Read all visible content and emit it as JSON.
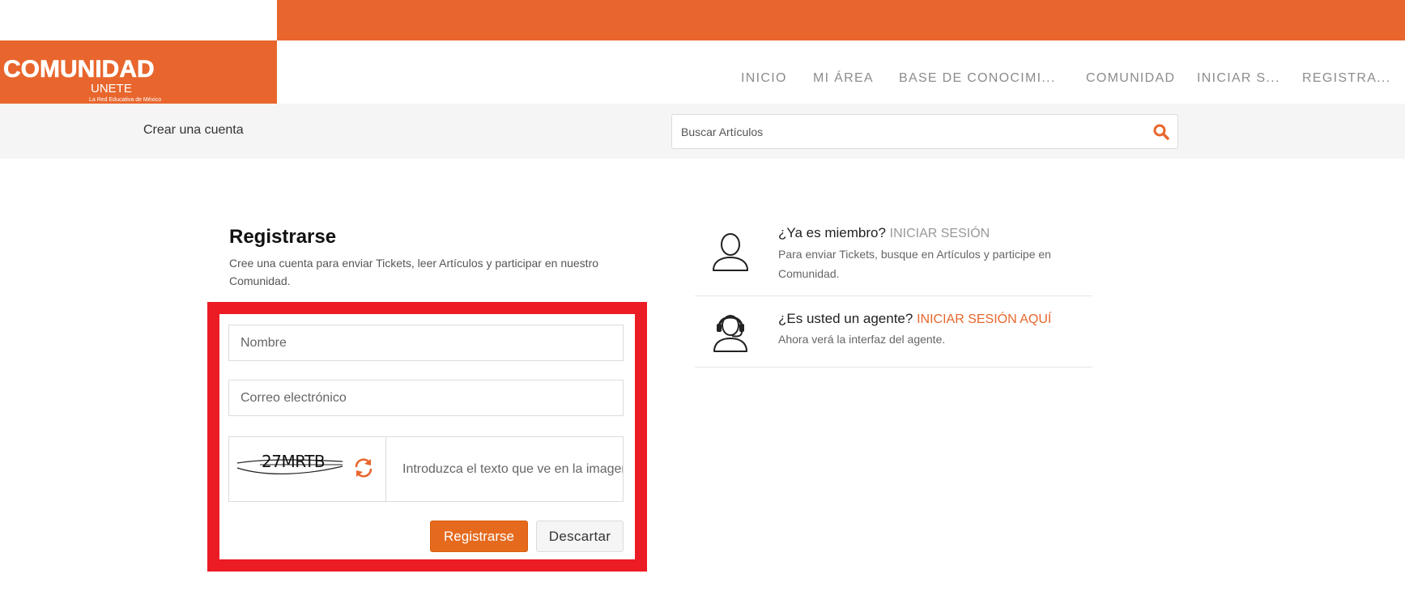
{
  "brand": {
    "logo_word": "COMUNIDAD",
    "logo_sub": "UNETE",
    "logo_tagline": "La Red Educativa de México",
    "accent": "#e8662d"
  },
  "nav": {
    "items": [
      {
        "label": "INICIO"
      },
      {
        "label": "MI ÁREA"
      },
      {
        "label": "BASE DE CONOCIMI..."
      },
      {
        "label": "COMUNIDAD"
      },
      {
        "label": "INICIAR S..."
      },
      {
        "label": "REGISTRA..."
      }
    ],
    "active_index": 5
  },
  "subbar": {
    "title": "Crear una cuenta",
    "search_placeholder": "Buscar Artículos",
    "search_icon": "search-icon"
  },
  "register": {
    "title": "Registrarse",
    "description": "Cree una cuenta para enviar Tickets, leer Artículos y participar en nuestro Comunidad.",
    "name_placeholder": "Nombre",
    "email_placeholder": "Correo electrónico",
    "captcha_code": "27MRTB",
    "captcha_placeholder": "Introduzca el texto que ve en la imagen",
    "submit_label": "Registrarse",
    "cancel_label": "Descartar",
    "highlight_color": "#ec1c24"
  },
  "member": {
    "question": "¿Ya es miembro?",
    "link": "INICIAR SESIÓN",
    "text": "Para enviar Tickets, busque en Artículos y participe en Comunidad.",
    "icon": "user-icon"
  },
  "agent": {
    "question": "¿Es usted un agente?",
    "link": "INICIAR SESIÓN AQUÍ",
    "text": "Ahora verá la interfaz del agente.",
    "icon": "headset-agent-icon"
  }
}
